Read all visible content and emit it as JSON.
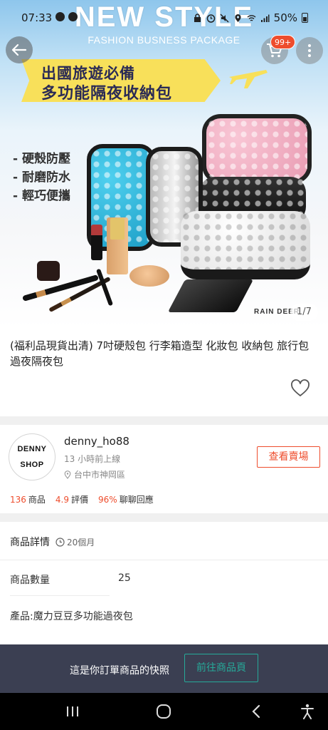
{
  "status_bar": {
    "time": "07:33",
    "battery": "50%"
  },
  "hero": {
    "banner_title": "NEW STYLE",
    "banner_subtitle": "FASHION BUSNESS PACKAGE",
    "promo_line1": "出國旅遊必備",
    "promo_line2": "多功能隔夜收納包",
    "features": [
      "- 硬殼防壓",
      "- 耐磨防水",
      "- 輕巧便攜"
    ],
    "brand_logo": "RAIN DEER",
    "page_indicator": "1/7",
    "cart_badge": "99+"
  },
  "product": {
    "title": "(福利品現貨出清) 7吋硬殼包 行李箱造型 化妝包 收納包 旅行包 過夜隔夜包"
  },
  "shop": {
    "avatar_line1": "DENNY",
    "avatar_line2": "SHOP",
    "name": "denny_ho88",
    "online_status": "13 小時前上線",
    "location": "台中市神岡區",
    "view_shop_label": "查看賣場",
    "stats": [
      {
        "value": "136",
        "label": "商品"
      },
      {
        "value": "4.9",
        "label": "評價"
      },
      {
        "value": "96%",
        "label": "聊聊回應"
      }
    ]
  },
  "details": {
    "header": "商品詳情",
    "age": "20個月",
    "quantity_label": "商品數量",
    "quantity_value": "25",
    "description": "產品:魔力豆豆多功能過夜包"
  },
  "snapshot_bar": {
    "text": "這是你訂單商品的快照",
    "goto_label": "前往商品頁",
    "accent_color": "#26aa99"
  },
  "colors": {
    "brand_orange": "#ee4d2d",
    "snapshot_bg": "#3b3f52"
  }
}
